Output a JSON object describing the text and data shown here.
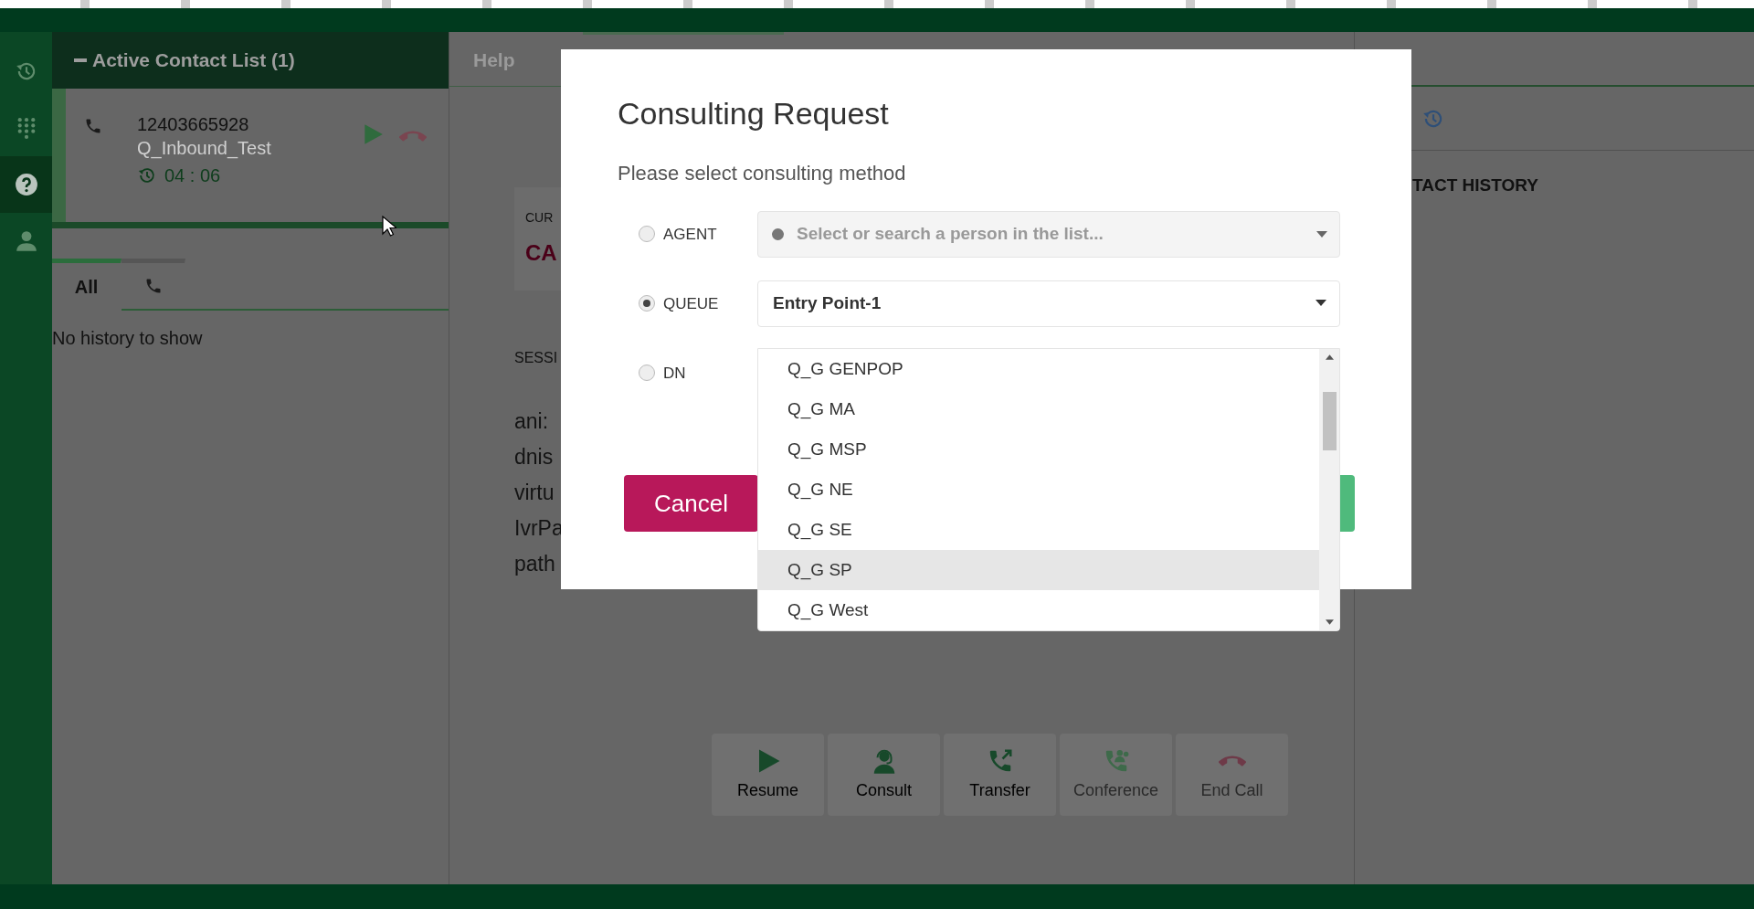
{
  "sidebar": {
    "items": [
      {
        "kind": "history",
        "selected": false
      },
      {
        "kind": "keypad",
        "selected": false
      },
      {
        "kind": "help",
        "selected": true
      },
      {
        "kind": "person",
        "selected": false
      }
    ]
  },
  "contact_list": {
    "title": "Active Contact List (1)",
    "contact": {
      "number": "12403665928",
      "queue": "Q_Inbound_Test",
      "duration": "04 : 06"
    }
  },
  "history_tabs": [
    {
      "kind": "text",
      "label": "All",
      "selected": true
    },
    {
      "kind": "phone",
      "selected": false
    }
  ],
  "history_empty": "No history to show",
  "center_tabs": [
    {
      "label": "Help",
      "selected": false
    },
    {
      "selected": true
    }
  ],
  "call_panel": {
    "card_label": "CUR",
    "card_value": "CA",
    "section": "SESSI",
    "fields": [
      "ani:",
      "dnis",
      "virtu",
      "IvrPa",
      "path"
    ]
  },
  "toolbar": [
    {
      "kind": "play",
      "label": "Resume",
      "disabled": false
    },
    {
      "kind": "headset",
      "label": "Consult",
      "disabled": false
    },
    {
      "kind": "transfer",
      "label": "Transfer",
      "disabled": false
    },
    {
      "kind": "conference",
      "label": "Conference",
      "disabled": true
    },
    {
      "kind": "hangup",
      "label": "End Call",
      "disabled": true
    }
  ],
  "right_panel": {
    "heading": "TACT HISTORY"
  },
  "modal": {
    "title": "Consulting Request",
    "subtitle": "Please select consulting method",
    "methods": [
      {
        "label": "AGENT",
        "selected": false
      },
      {
        "label": "QUEUE",
        "selected": true
      },
      {
        "label": "DN",
        "selected": false
      }
    ],
    "agent_field": {
      "placeholder": "Select or search a person in the list..."
    },
    "queue_field": {
      "value": "Entry Point-1"
    },
    "queue_options": [
      {
        "label": "Q_G GENPOP",
        "selected": false
      },
      {
        "label": "Q_G MA",
        "selected": false
      },
      {
        "label": "Q_G MSP",
        "selected": false
      },
      {
        "label": "Q_G NE",
        "selected": false
      },
      {
        "label": "Q_G SE",
        "selected": false
      },
      {
        "label": "Q_G SP",
        "selected": true
      },
      {
        "label": "Q_G West",
        "selected": false
      }
    ],
    "cancel": "Cancel"
  }
}
